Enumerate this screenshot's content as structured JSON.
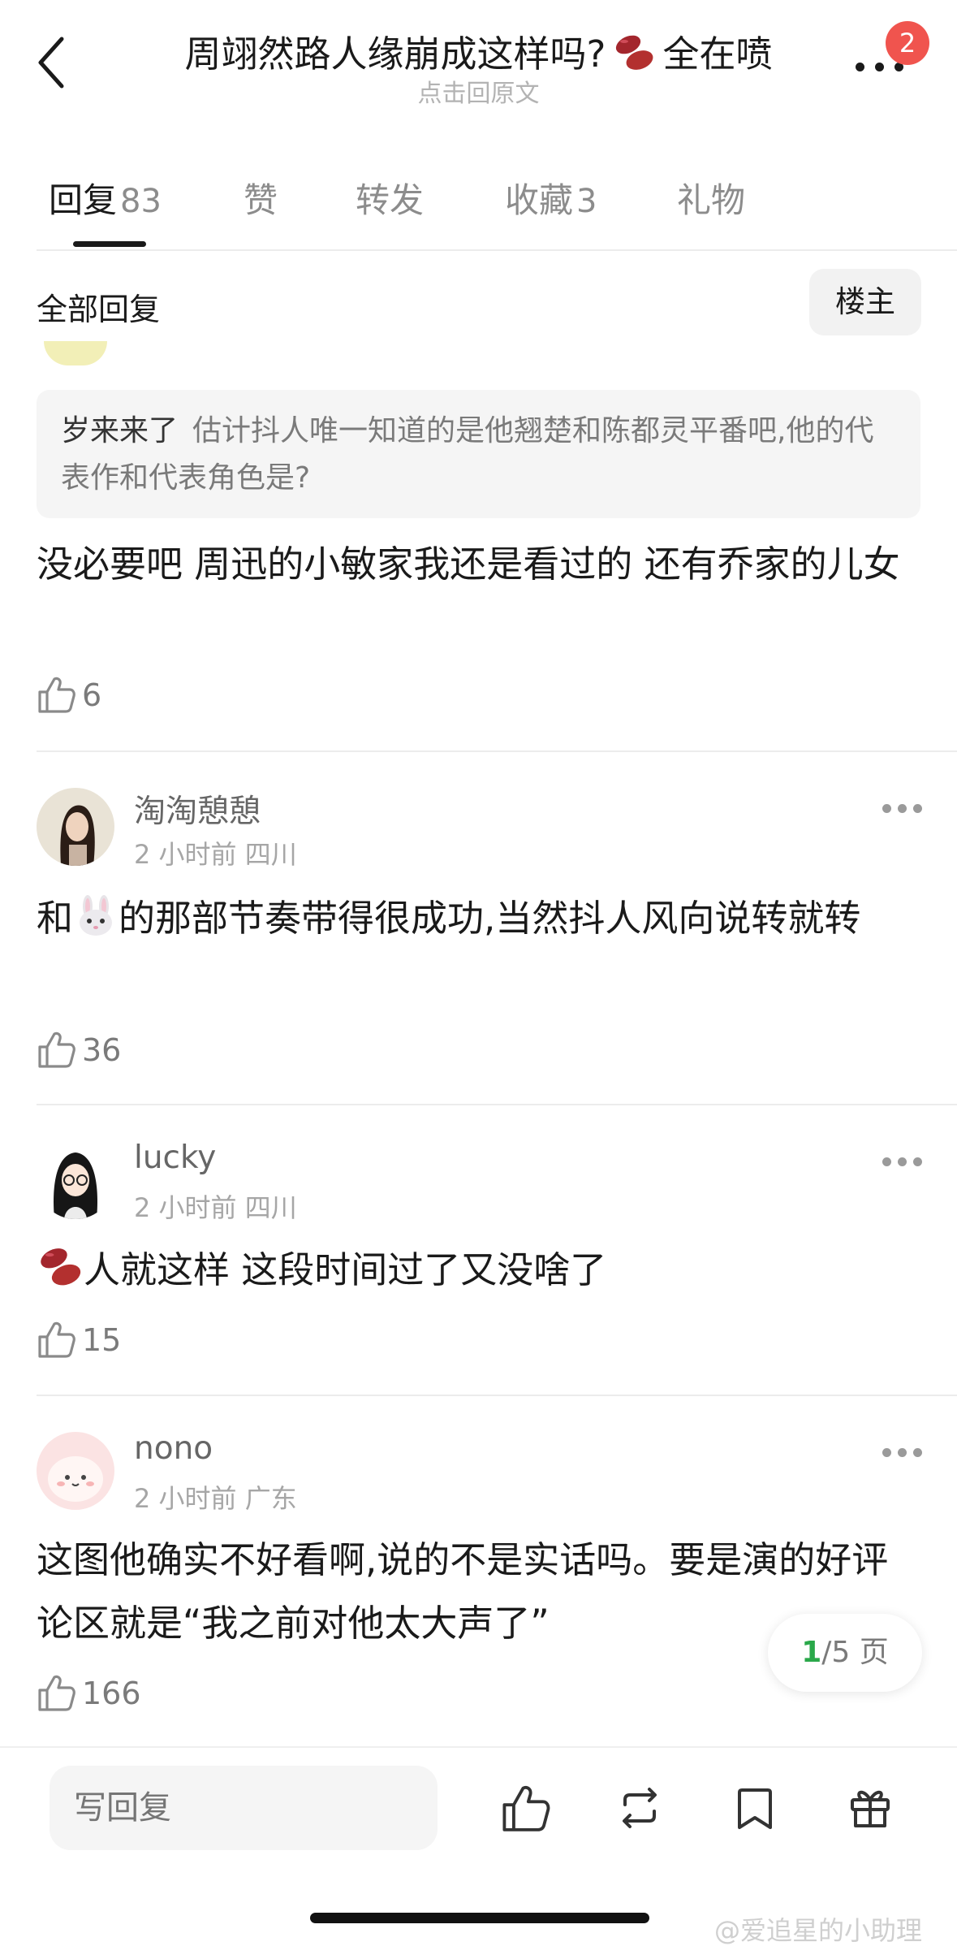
{
  "header": {
    "title_part1": "周翊然路人缘崩成这样吗?",
    "title_part2": "全在喷",
    "title_emoji": "beans-emoji",
    "subtitle": "点击回原文",
    "notification_count": "2"
  },
  "tabs": [
    {
      "label": "回复",
      "count": "83"
    },
    {
      "label": "赞",
      "count": ""
    },
    {
      "label": "转发",
      "count": ""
    },
    {
      "label": "收藏",
      "count": "3"
    },
    {
      "label": "礼物",
      "count": ""
    }
  ],
  "filter": {
    "label": "全部回复",
    "louzhu": "楼主"
  },
  "comments": [
    {
      "quote_name": "岁来来了",
      "quote_text": "估计抖人唯一知道的是他翘楚和陈都灵平番吧,他的代表作和代表角色是?",
      "body": "没必要吧 周迅的小敏家我还是看过的 还有乔家的儿女",
      "likes": "6"
    },
    {
      "name": "淘淘憩憩",
      "meta": "2 小时前 四川",
      "body_before": "和",
      "body_emoji": "rabbit-emoji",
      "body_after": "的那部节奏带得很成功,当然抖人风向说转就转",
      "likes": "36"
    },
    {
      "name": "lucky",
      "meta": "2 小时前 四川",
      "body_emoji": "beans-emoji",
      "body": "人就这样 这段时间过了又没啥了",
      "likes": "15"
    },
    {
      "name": "nono",
      "meta": "2 小时前 广东",
      "body": "这图他确实不好看啊,说的不是实话吗。要是演的好评论区就是“我之前对他太大声了”",
      "likes": "166"
    }
  ],
  "pager": {
    "current": "1",
    "total": "/5 页"
  },
  "bottom_bar": {
    "reply_placeholder": "写回复"
  },
  "watermark": "@爱追星的小助理",
  "colors": {
    "badge": "#f0544e",
    "pager_current": "#2aa84a",
    "text": "#1a1a1a",
    "muted": "#8c8c8c"
  }
}
